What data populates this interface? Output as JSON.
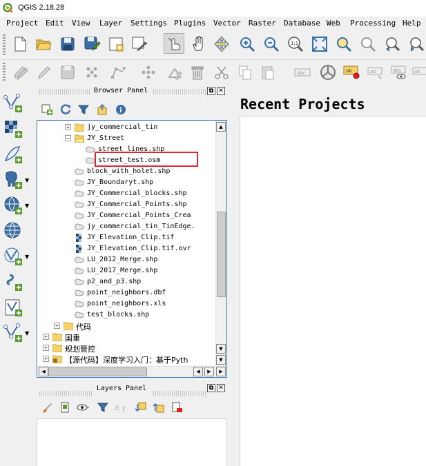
{
  "window": {
    "title": "QGIS 2.18.28"
  },
  "menu": [
    "Project",
    "Edit",
    "View",
    "Layer",
    "Settings",
    "Plugins",
    "Vector",
    "Raster",
    "Database",
    "Web",
    "Processing",
    "Help"
  ],
  "browser_panel": {
    "title": "Browser Panel",
    "tree": [
      {
        "label": "jy_commercial_tin",
        "type": "folder",
        "expander": "+"
      },
      {
        "label": "JY_Street",
        "type": "folder-open",
        "expander": "−"
      },
      {
        "label": "street_lines.shp",
        "type": "vector"
      },
      {
        "label": "street_test.osm",
        "type": "vector"
      },
      {
        "label": "block_with_holet.shp",
        "type": "vector"
      },
      {
        "label": "JY_Boundaryt.shp",
        "type": "vector"
      },
      {
        "label": "JY_Commercial_blocks.shp",
        "type": "vector"
      },
      {
        "label": "JY_Commercial_Points.shp",
        "type": "vector"
      },
      {
        "label": "JY_Commercial_Points_Crea",
        "type": "vector"
      },
      {
        "label": "jy_commercial_tin_TinEdge.",
        "type": "vector"
      },
      {
        "label": "JY_Elevation_Clip.tif",
        "type": "raster"
      },
      {
        "label": "JY_Elevation_Clip.tif.ovr",
        "type": "raster"
      },
      {
        "label": "LU_2012_Merge.shp",
        "type": "vector"
      },
      {
        "label": "LU_2017_Merge.shp",
        "type": "vector"
      },
      {
        "label": "p2_and_p3.shp",
        "type": "vector"
      },
      {
        "label": "point_neighbors.dbf",
        "type": "vector"
      },
      {
        "label": "point_neighbors.xls",
        "type": "vector"
      },
      {
        "label": "test_blocks.shp",
        "type": "vector"
      },
      {
        "label": "代码",
        "type": "folder",
        "expander": "+"
      },
      {
        "label": "国重",
        "type": "folder",
        "expander": "+"
      },
      {
        "label": "规划管控",
        "type": "folder",
        "expander": "+"
      },
      {
        "label": "【源代码】深度学习入门：基于Pyth",
        "type": "folder-special",
        "expander": "+"
      }
    ]
  },
  "layers_panel": {
    "title": "Layers Panel"
  },
  "main": {
    "recent_title": "Recent Projects"
  },
  "colors": {
    "highlight": "#e3262e",
    "tree_border": "#3d7bb5",
    "folder": "#f6d26b"
  }
}
